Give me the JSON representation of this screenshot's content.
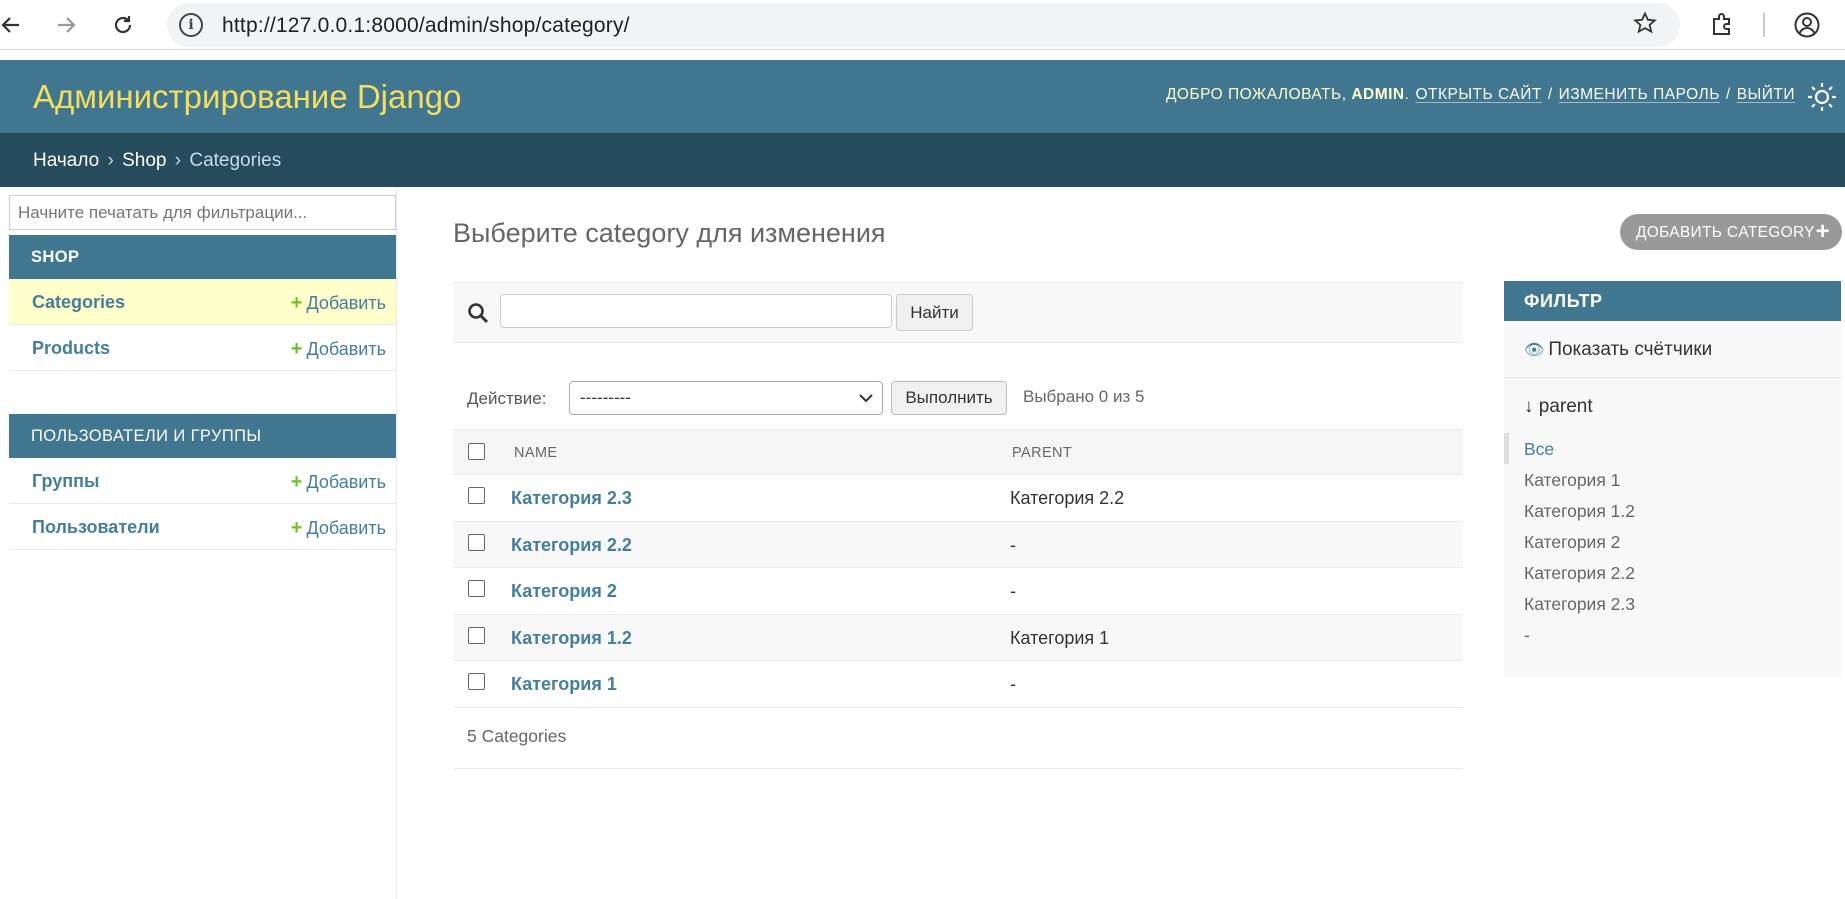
{
  "browser": {
    "url": "http://127.0.0.1:8000/admin/shop/category/"
  },
  "header": {
    "branding": "Администрирование Django",
    "welcome": "Добро пожаловать,",
    "username": "admin",
    "view_site": "Открыть сайт",
    "change_password": "Изменить пароль",
    "logout": "Выйти"
  },
  "breadcrumbs": {
    "home": "Начало",
    "app": "Shop",
    "current": "Categories"
  },
  "sidebar": {
    "filter_placeholder": "Начните печатать для фильтрации...",
    "apps": [
      {
        "name": "Shop",
        "models": [
          {
            "name": "Categories",
            "add": "Добавить"
          },
          {
            "name": "Products",
            "add": "Добавить"
          }
        ]
      },
      {
        "name": "Пользователи и группы",
        "models": [
          {
            "name": "Группы",
            "add": "Добавить"
          },
          {
            "name": "Пользователи",
            "add": "Добавить"
          }
        ]
      }
    ]
  },
  "content": {
    "title": "Выберите category для изменения",
    "add_button": "Добавить category",
    "search_button": "Найти",
    "action_label": "Действие:",
    "action_selected": "---------",
    "run_button": "Выполнить",
    "action_counter": "Выбрано 0 из 5",
    "columns": [
      "Name",
      "Parent"
    ],
    "rows": [
      {
        "name": "Категория 2.3",
        "parent": "Категория 2.2"
      },
      {
        "name": "Категория 2.2",
        "parent": "-"
      },
      {
        "name": "Категория 2",
        "parent": "-"
      },
      {
        "name": "Категория 1.2",
        "parent": "Категория 1"
      },
      {
        "name": "Категория 1",
        "parent": "-"
      }
    ],
    "paginator": "5 Categories"
  },
  "filter": {
    "title": "Фильтр",
    "show_counts": "Показать счётчики",
    "field": "↓ parent",
    "choices": [
      "Все",
      "Категория 1",
      "Категория 1.2",
      "Категория 2",
      "Категория 2.2",
      "Категория 2.3",
      "-"
    ]
  },
  "colors": {
    "header_bg": "#417690",
    "breadcrumbs_bg": "#264b5d",
    "branding": "#f5dd5d",
    "link": "#447e9b",
    "add_green": "#70bf2b",
    "current_model_bg": "#ffffcc"
  }
}
